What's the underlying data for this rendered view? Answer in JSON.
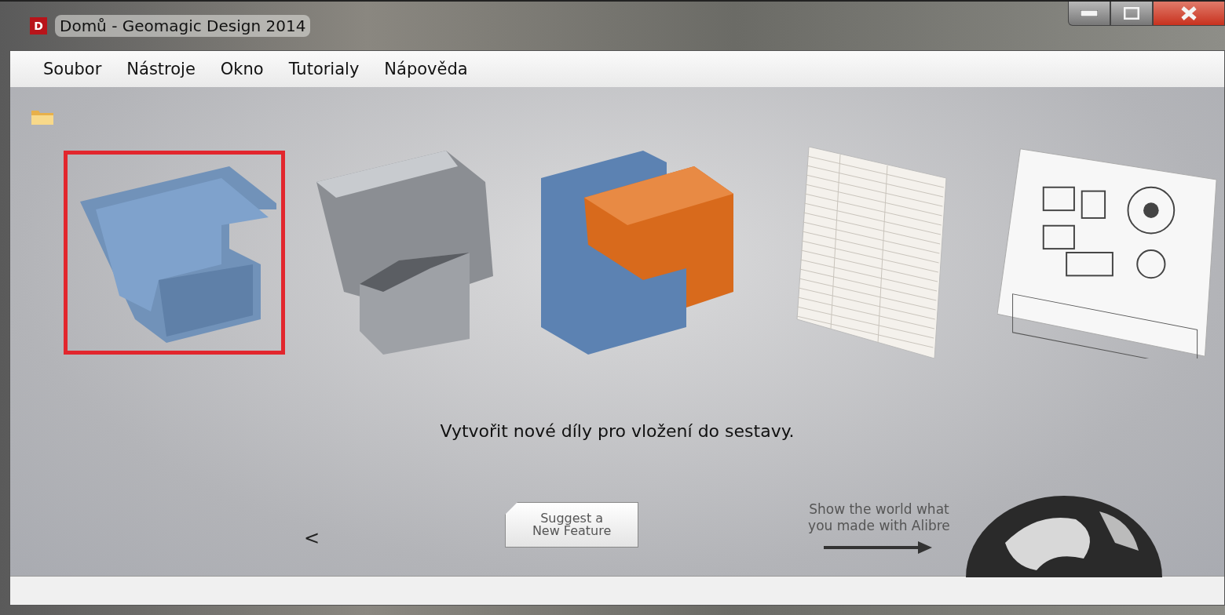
{
  "window": {
    "app_icon": "D",
    "title": "Domů - Geomagic Design 2014"
  },
  "menu": [
    {
      "label": "Soubor"
    },
    {
      "label": "Nástroje"
    },
    {
      "label": "Okno"
    },
    {
      "label": "Tutorialy"
    },
    {
      "label": "Nápověda"
    }
  ],
  "gallery": [
    {
      "kind": "part",
      "selected": true
    },
    {
      "kind": "sheetmetal",
      "selected": false
    },
    {
      "kind": "assembly",
      "selected": false
    },
    {
      "kind": "bom",
      "selected": false
    },
    {
      "kind": "drawing",
      "selected": false
    }
  ],
  "description": "Vytvořit nové díly pro vložení do sestavy.",
  "prev_arrow": "<",
  "suggest_button": {
    "line_1": "Suggest a",
    "line_2": "New Feature"
  },
  "promo": {
    "line_1": "Show the world what",
    "line_2": "you made with Alibre"
  }
}
